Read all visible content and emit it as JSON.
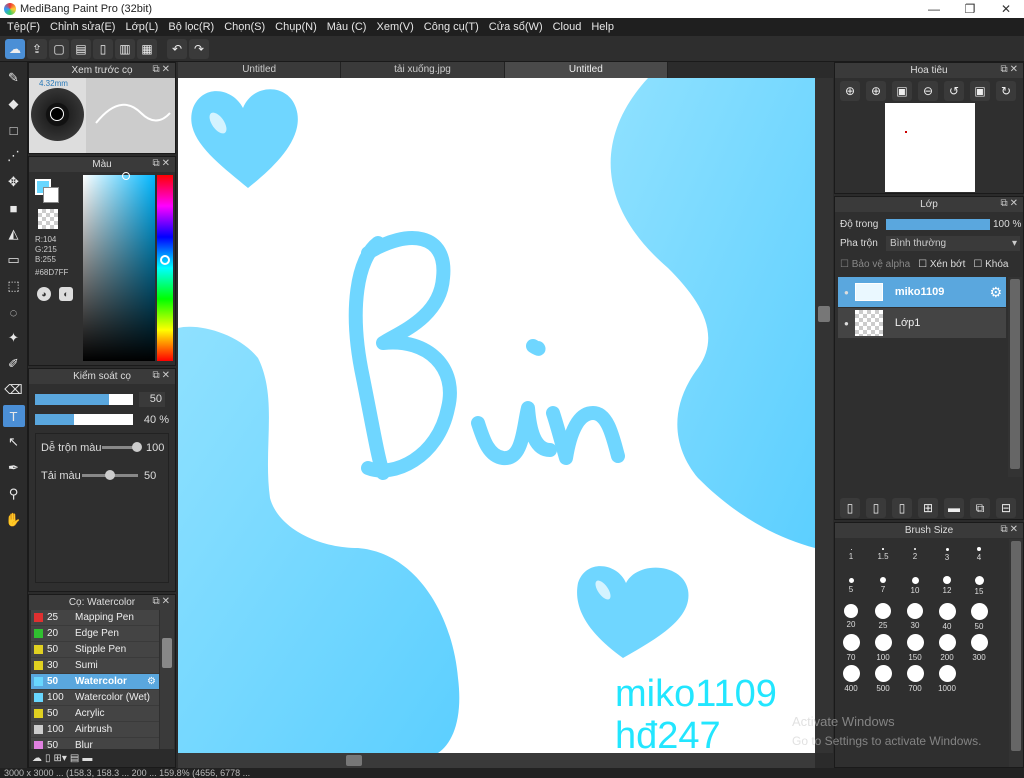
{
  "app": {
    "title": "MediBang Paint Pro (32bit)",
    "window_buttons": [
      "—",
      "❐",
      "✕"
    ]
  },
  "menu": [
    "Tệp(F)",
    "Chỉnh sửa(E)",
    "Lớp(L)",
    "Bộ lọc(R)",
    "Chọn(S)",
    "Chụp(N)",
    "Màu (C)",
    "Xem(V)",
    "Công cụ(T)",
    "Cửa sổ(W)",
    "Cloud",
    "Help"
  ],
  "preview": {
    "title": "Xem trước cọ",
    "size": "4.32mm"
  },
  "color": {
    "title": "Màu",
    "r": "R:104",
    "g": "G:215",
    "b": "B:255",
    "hex": "#68D7FF",
    "accent": "#68D7FF"
  },
  "brush_control": {
    "title": "Kiểm soát cọ",
    "size_value": "50",
    "opacity_value": "40 %",
    "blend_label": "Dễ trộn màu",
    "blend_value": "100",
    "load_label": "Tải màu",
    "load_value": "50"
  },
  "brush_list": {
    "title": "Cọ: Watercolor",
    "items": [
      {
        "size": "25",
        "name": "Mapping Pen",
        "color": "#e03030"
      },
      {
        "size": "20",
        "name": "Edge Pen",
        "color": "#30c030"
      },
      {
        "size": "50",
        "name": "Stipple Pen",
        "color": "#e0d020"
      },
      {
        "size": "30",
        "name": "Sumi",
        "color": "#e0d020"
      },
      {
        "size": "50",
        "name": "Watercolor",
        "color": "#68D7FF"
      },
      {
        "size": "100",
        "name": "Watercolor (Wet)",
        "color": "#68D7FF"
      },
      {
        "size": "50",
        "name": "Acrylic",
        "color": "#e0d020"
      },
      {
        "size": "100",
        "name": "Airbrush",
        "color": "#cccccc"
      },
      {
        "size": "50",
        "name": "Blur",
        "color": "#e080e0"
      }
    ]
  },
  "tabs": [
    "Untitled",
    "tải xuống.jpg",
    "Untitled"
  ],
  "canvas": {
    "signature1": "miko1109",
    "signature2": "hđ247",
    "letter_text": "Bùn"
  },
  "navigator": {
    "title": "Hoa tiêu"
  },
  "layers": {
    "title": "Lớp",
    "opacity_label": "Độ trong",
    "opacity_value": "100 %",
    "blend_label": "Pha trộn",
    "blend_value": "Bình thường",
    "protect_alpha": "Bảo vệ alpha",
    "clip": "Xén bớt",
    "lock": "Khóa",
    "items": [
      {
        "name": "miko1109"
      },
      {
        "name": "Lớp1"
      }
    ]
  },
  "brush_size": {
    "title": "Brush Size",
    "values": [
      "1",
      "1.5",
      "2",
      "3",
      "4",
      "5",
      "7",
      "10",
      "12",
      "15",
      "20",
      "25",
      "30",
      "40",
      "50",
      "70",
      "100",
      "150",
      "200",
      "300",
      "400",
      "500",
      "700",
      "1000"
    ]
  },
  "watermark": {
    "line1": "Activate Windows",
    "line2": "Go to Settings to activate Windows."
  },
  "status": "3000 x 3000 ... (158.3, 158.3 ... 200 ... 159.8% (4656, 6778 ..."
}
